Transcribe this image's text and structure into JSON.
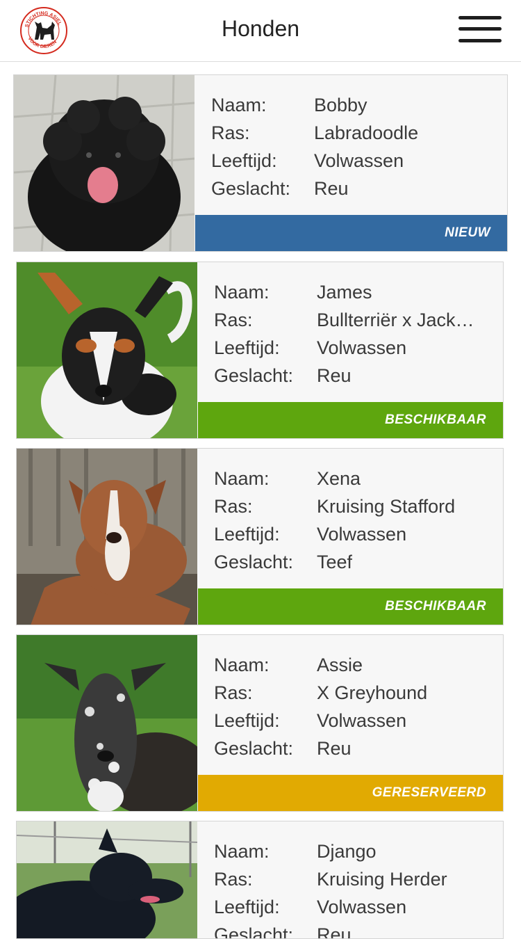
{
  "header": {
    "logo_text": "STICHTING ASIEL VOOR DIEREN",
    "title": "Honden",
    "menu_icon": "hamburger-menu-icon"
  },
  "labels": {
    "name": "Naam:",
    "breed": "Ras:",
    "age": "Leeftijd:",
    "sex": "Geslacht:"
  },
  "status_colors": {
    "NIEUW": "#336aa1",
    "BESCHIKBAAR": "#5ea60e",
    "GERESERVEERD": "#e1aa02"
  },
  "dogs": [
    {
      "name": "Bobby",
      "breed": "Labradoodle",
      "age": "Volwassen",
      "sex": "Reu",
      "status": "NIEUW"
    },
    {
      "name": "James",
      "breed": "Bullterriër x Jack…",
      "age": "Volwassen",
      "sex": "Reu",
      "status": "BESCHIKBAAR"
    },
    {
      "name": "Xena",
      "breed": "Kruising Stafford",
      "age": "Volwassen",
      "sex": "Teef",
      "status": "BESCHIKBAAR"
    },
    {
      "name": "Assie",
      "breed": "X Greyhound",
      "age": "Volwassen",
      "sex": "Reu",
      "status": "GERESERVEERD"
    },
    {
      "name": "Django",
      "breed": "Kruising Herder",
      "age": "Volwassen",
      "sex": "Reu",
      "status": ""
    }
  ]
}
